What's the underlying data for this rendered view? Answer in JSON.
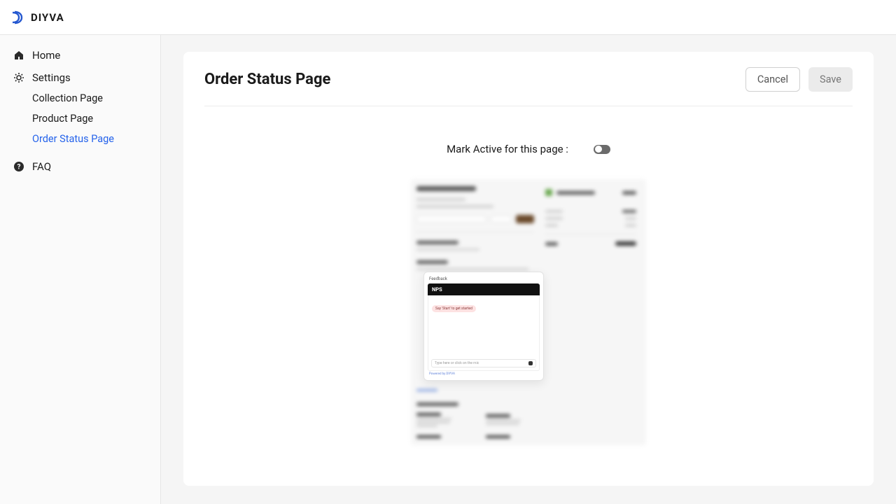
{
  "header": {
    "brand": "DIYVA"
  },
  "sidebar": {
    "home": "Home",
    "settings": "Settings",
    "sub": {
      "collection": "Collection Page",
      "product": "Product Page",
      "order_status": "Order Status Page"
    },
    "faq": "FAQ"
  },
  "page": {
    "title": "Order Status Page",
    "cancel": "Cancel",
    "save": "Save",
    "toggle_label": "Mark Active for this page :",
    "toggle_on": false
  },
  "preview": {
    "feedback_label": "Feedback",
    "nps_title": "NPS",
    "chip": "Say 'Start' to get started",
    "input_placeholder": "Type here or click on the mic",
    "powered": "Powered by DIYVA"
  }
}
